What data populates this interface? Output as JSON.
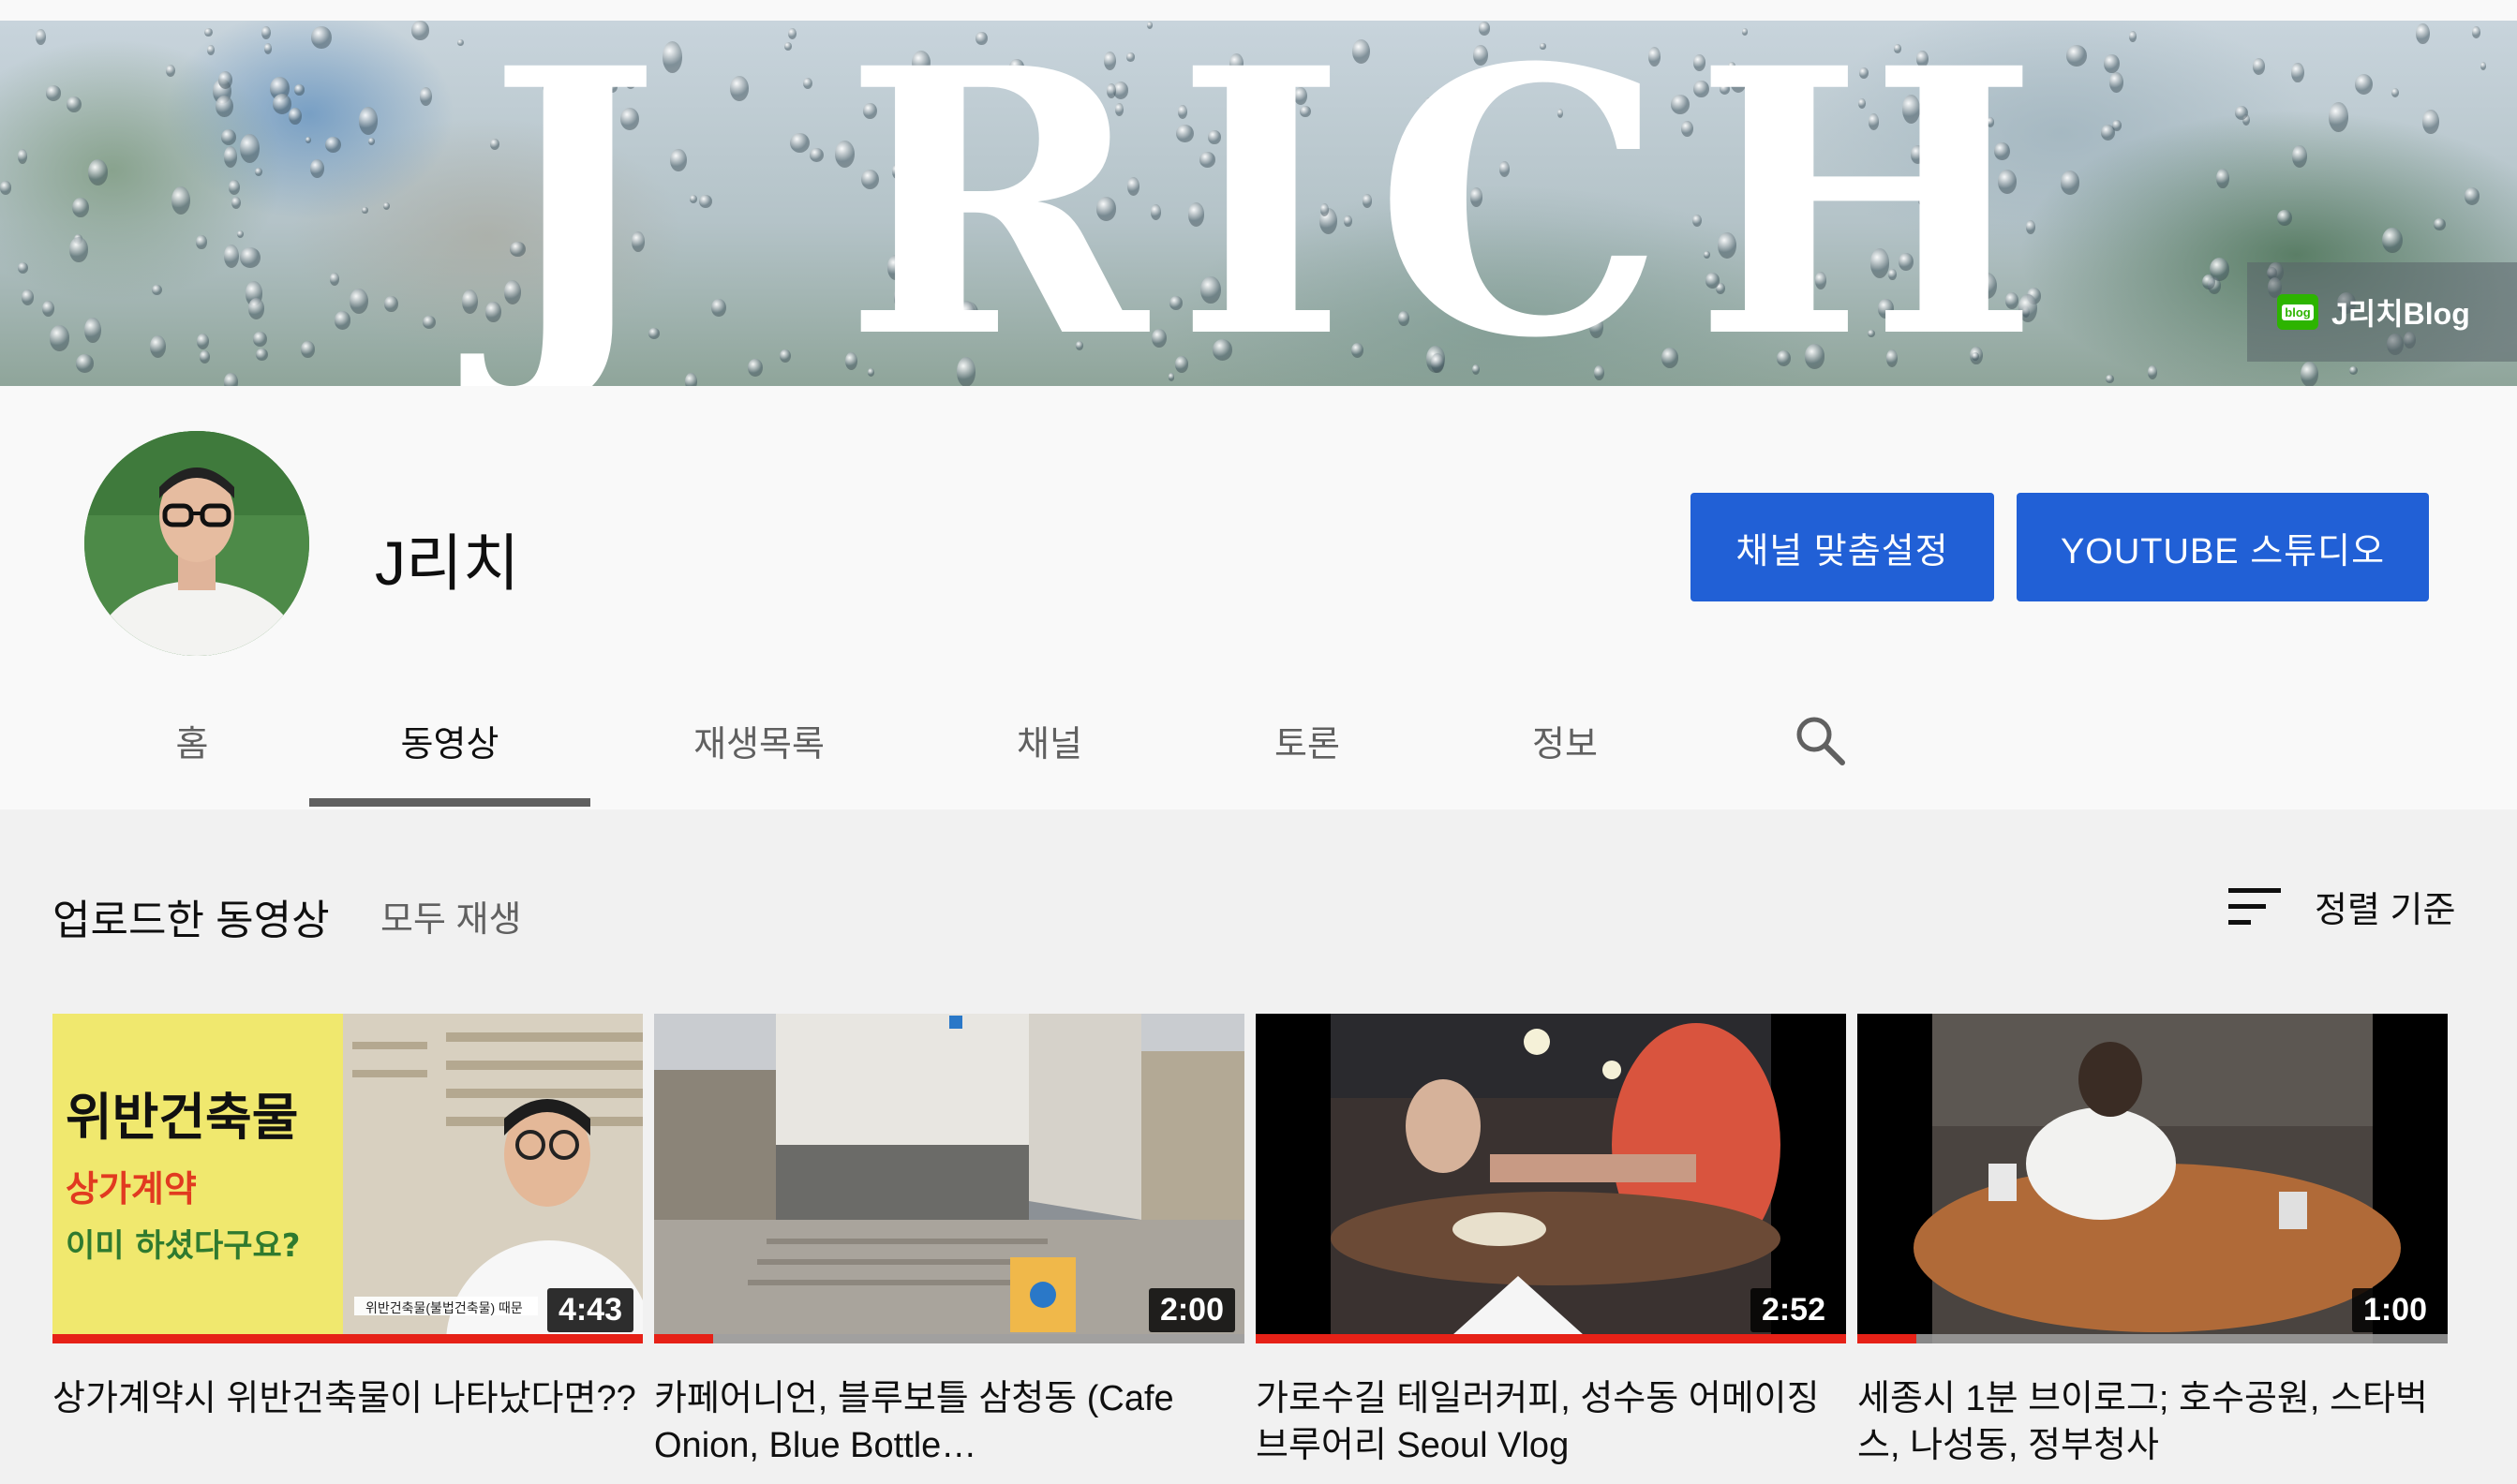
{
  "banner": {
    "title": "J RICH",
    "blog_link_label": "J리치Blog",
    "blog_icon_text": "blog"
  },
  "channel": {
    "name": "J리치",
    "customize_button": "채널 맞춤설정",
    "studio_button": "YOUTUBE 스튜디오"
  },
  "tabs": [
    {
      "label": "홈",
      "active": false
    },
    {
      "label": "동영상",
      "active": true
    },
    {
      "label": "재생목록",
      "active": false
    },
    {
      "label": "채널",
      "active": false
    },
    {
      "label": "토론",
      "active": false
    },
    {
      "label": "정보",
      "active": false
    }
  ],
  "search_icon": "search-icon",
  "section": {
    "title": "업로드한 동영상",
    "play_all": "모두 재생",
    "sort_label": "정렬 기준",
    "sort_icon": "sort-icon"
  },
  "videos": [
    {
      "title": "상가계약시 위반건축물이 나타났다면??",
      "duration": "4:43",
      "watched_fraction": 1.0,
      "thumb_text": {
        "line1": "위반건축물",
        "line2": "상가계약",
        "line3": "이미  하셨다구요?",
        "caption": "위반건축물(불법건축물) 때문"
      }
    },
    {
      "title": "카페어니언, 블루보틀 삼청동 (Cafe Onion, Blue Bottle…",
      "duration": "2:00",
      "watched_fraction": 0.1
    },
    {
      "title": "가로수길 테일러커피, 성수동 어메이징브루어리 Seoul Vlog",
      "duration": "2:52",
      "watched_fraction": 1.0
    },
    {
      "title": "세종시 1분 브이로그; 호수공원, 스타벅스, 나성동, 정부청사",
      "duration": "1:00",
      "watched_fraction": 0.1
    }
  ],
  "colors": {
    "primary_button": "#2160d6",
    "progress_red": "#e62117",
    "page_bg": "#f9f9f9",
    "content_bg": "#f1f1f1"
  }
}
